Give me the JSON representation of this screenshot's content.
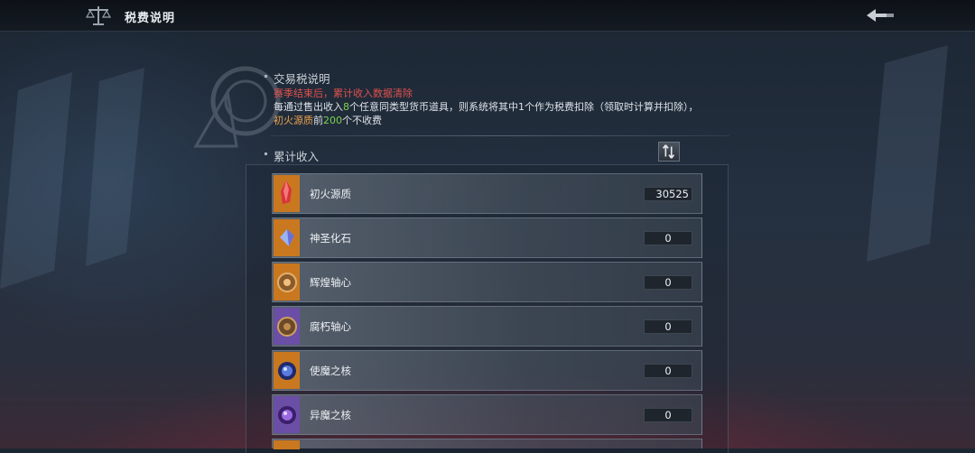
{
  "header": {
    "title": "税费说明"
  },
  "tax_section": {
    "title": "交易税说明",
    "notice": "赛季结束后，累计收入数据清除",
    "desc_part1": "每通过售出收入",
    "desc_num1": "8",
    "desc_part2": "个任意同类型货币道具，则系统将其中1个作为税费扣除（领取时计算并扣除），",
    "desc_item": "初火源质",
    "desc_part3": "前",
    "desc_num2": "200",
    "desc_part4": "个不收费"
  },
  "income_section": {
    "title": "累计收入",
    "items": [
      {
        "name": "初火源质",
        "count": "30525",
        "icon": "red-crystal-icon"
      },
      {
        "name": "神圣化石",
        "count": "0",
        "icon": "blue-crystal-icon"
      },
      {
        "name": "辉煌轴心",
        "count": "0",
        "icon": "bronze-gear-icon"
      },
      {
        "name": "腐朽轴心",
        "count": "0",
        "icon": "purple-gear-icon"
      },
      {
        "name": "使魔之核",
        "count": "0",
        "icon": "blue-orb-icon"
      },
      {
        "name": "异魔之核",
        "count": "0",
        "icon": "purple-orb-icon"
      }
    ]
  },
  "colors": {
    "notice_red": "#e0514e",
    "highlight_green": "#7ed34f",
    "highlight_orange": "#e9a24e",
    "icon_bg_orange": "#c9781f",
    "icon_bg_purple": "#6b4ea6"
  }
}
